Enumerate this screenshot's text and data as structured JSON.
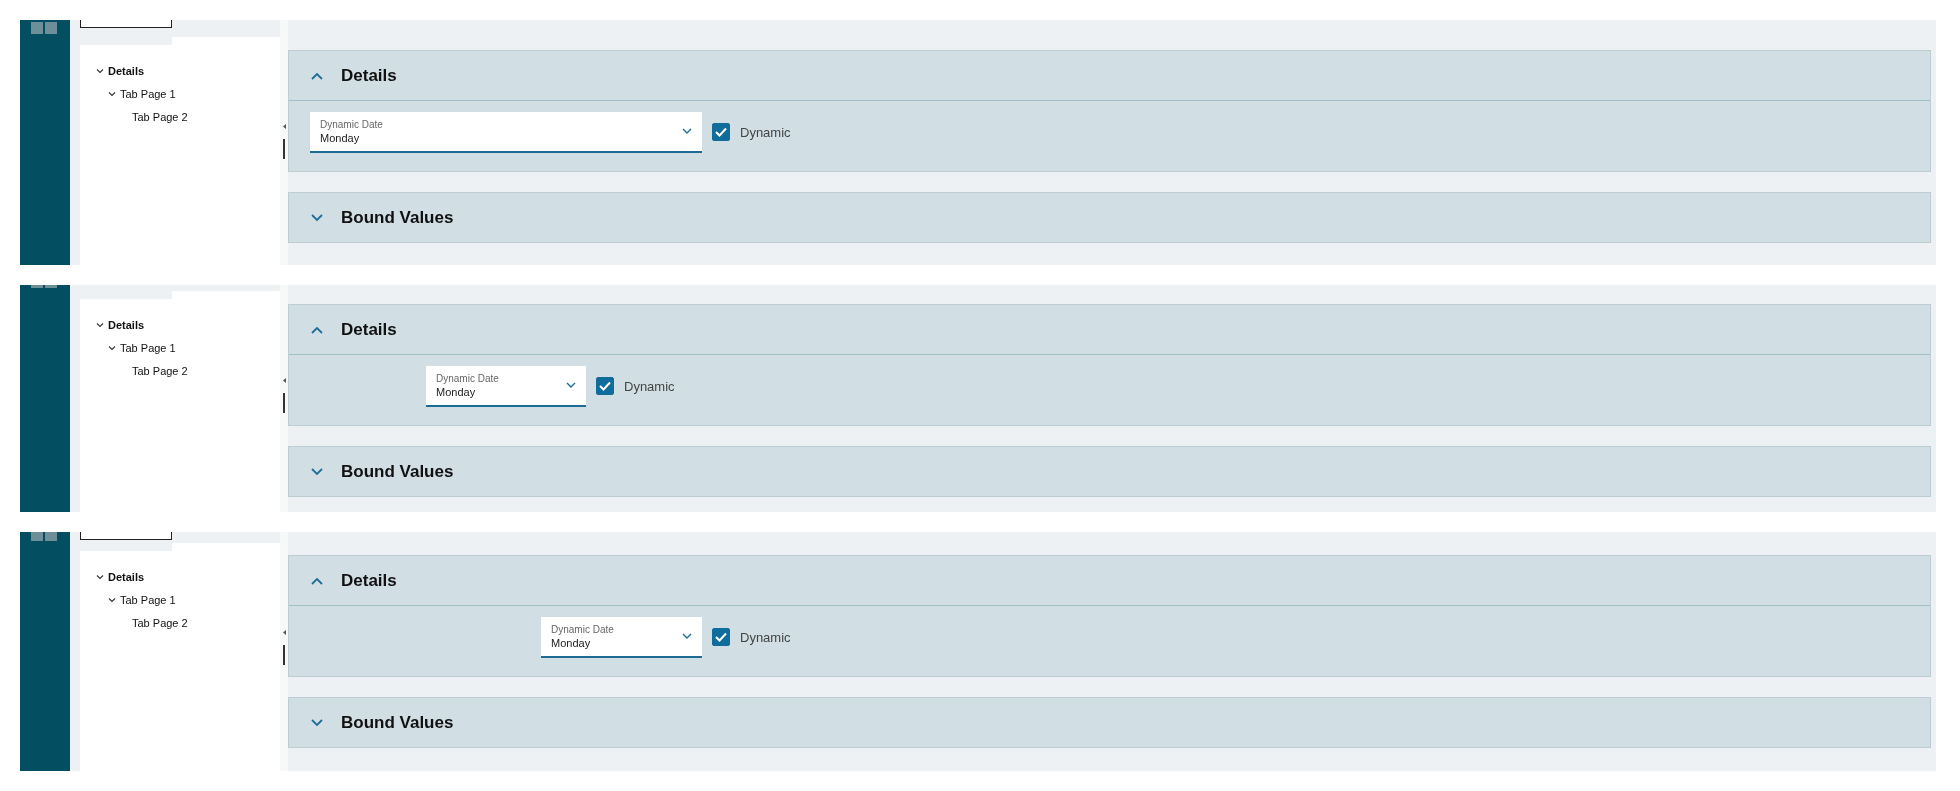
{
  "views": [
    {
      "tree": [
        {
          "label": "Details",
          "expanded": true,
          "children": [
            {
              "label": "Tab Page 1",
              "expanded": true,
              "children": [
                {
                  "label": "Tab Page 2"
                }
              ]
            }
          ]
        }
      ],
      "sections": [
        {
          "title": "Details",
          "expanded": true,
          "field": {
            "label": "Dynamic Date",
            "value": "Monday"
          },
          "checkbox": {
            "label": "Dynamic",
            "checked": true
          }
        },
        {
          "title": "Bound Values",
          "expanded": false
        }
      ]
    },
    {
      "tree": [
        {
          "label": "Details",
          "expanded": true,
          "children": [
            {
              "label": "Tab Page 1",
              "expanded": true,
              "children": [
                {
                  "label": "Tab Page 2"
                }
              ]
            }
          ]
        }
      ],
      "sections": [
        {
          "title": "Details",
          "expanded": true,
          "field": {
            "label": "Dynamic Date",
            "value": "Monday"
          },
          "checkbox": {
            "label": "Dynamic",
            "checked": true
          }
        },
        {
          "title": "Bound Values",
          "expanded": false
        }
      ]
    },
    {
      "tree": [
        {
          "label": "Details",
          "expanded": true,
          "children": [
            {
              "label": "Tab Page 1",
              "expanded": true,
              "children": [
                {
                  "label": "Tab Page 2"
                }
              ]
            }
          ]
        }
      ],
      "sections": [
        {
          "title": "Details",
          "expanded": true,
          "field": {
            "label": "Dynamic Date",
            "value": "Monday"
          },
          "checkbox": {
            "label": "Dynamic",
            "checked": true
          }
        },
        {
          "title": "Bound Values",
          "expanded": false
        }
      ]
    }
  ]
}
